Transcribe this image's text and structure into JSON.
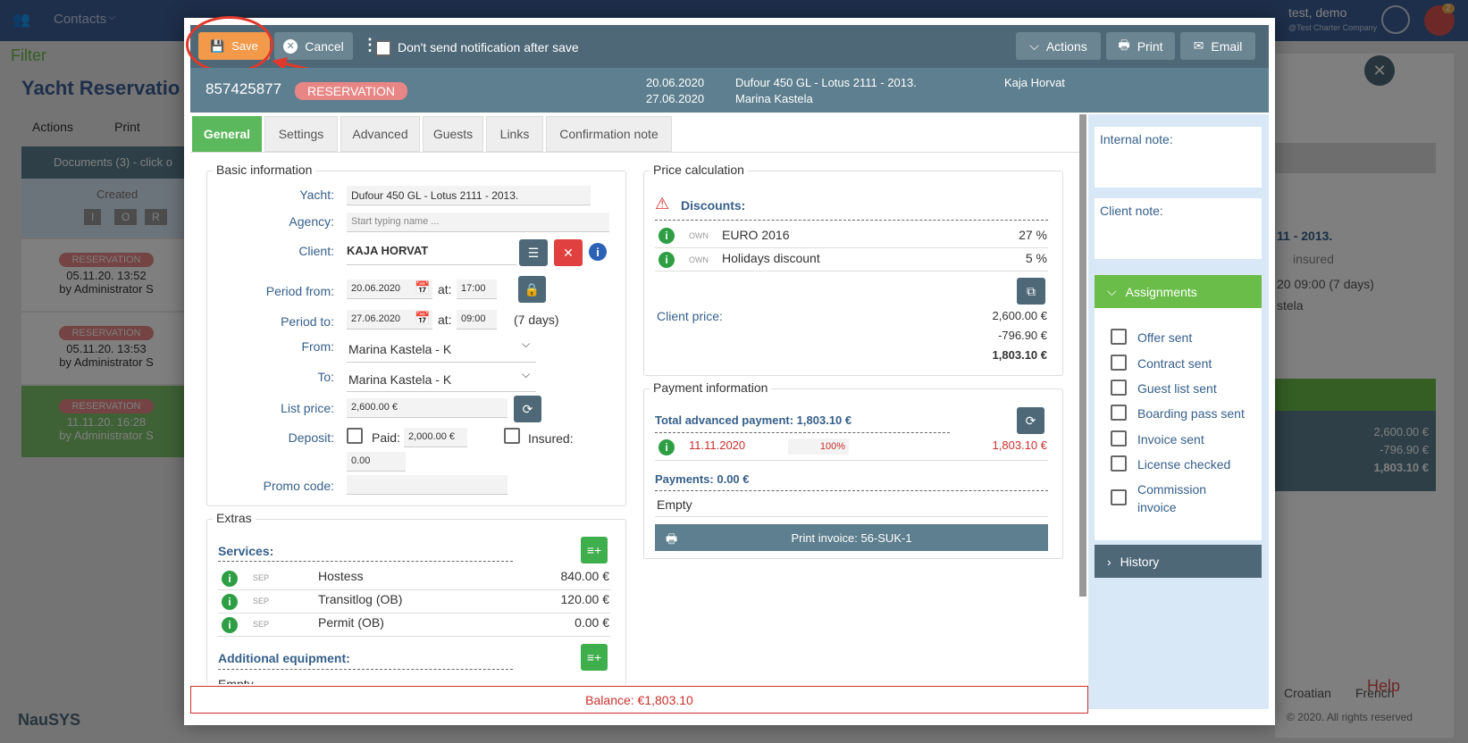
{
  "background": {
    "nav_contacts": "Contacts",
    "user_name": "test, demo",
    "company": "@Test Charter Company",
    "filter_label": "Filter",
    "page_title": "Yacht Reservatio",
    "actions": "Actions",
    "print": "Print",
    "documents": "Documents (3) - click o",
    "created": "Created",
    "col_i": "I",
    "col_o": "O",
    "col_r": "R",
    "rows": [
      {
        "badge": "RESERVATION",
        "date": "05.11.20. 13:52",
        "by": "by Administrator S"
      },
      {
        "badge": "RESERVATION",
        "date": "05.11.20. 13:53",
        "by": "by Administrator S"
      },
      {
        "badge": "RESERVATION",
        "date": "11.11.20. 16:28",
        "by": "by Administrator S"
      }
    ],
    "logo": "NauSYS",
    "right_yacht": "11 - 2013.",
    "right_insured": "insured",
    "right_period": "20 09:00 (7 days)",
    "right_marina": "stela",
    "right_price1": "2,600.00 €",
    "right_price2": "-796.90 €",
    "right_price3": "1,803.10 €",
    "lang_croatian": "Croatian",
    "lang_french": "French",
    "help": "Help",
    "copyright": "© 2020. All rights reserved",
    "notif_count": "2"
  },
  "toolbar": {
    "save": "Save",
    "cancel": "Cancel",
    "dont_send": "Don't send notification after save",
    "actions": "Actions",
    "print": "Print",
    "email": "Email"
  },
  "header": {
    "id": "857425877",
    "badge": "RESERVATION",
    "date_from": "20.06.2020",
    "date_to": "27.06.2020",
    "yacht": "Dufour 450 GL - Lotus 2111 - 2013.",
    "marina": "Marina Kastela",
    "client": "Kaja Horvat"
  },
  "tabs": [
    "General",
    "Settings",
    "Advanced",
    "Guests",
    "Links",
    "Confirmation note"
  ],
  "basic": {
    "legend": "Basic information",
    "yacht_label": "Yacht:",
    "yacht_value": "Dufour 450 GL - Lotus 2111 - 2013.",
    "agency_label": "Agency:",
    "agency_placeholder": "Start typing name ...",
    "client_label": "Client:",
    "client_value": "KAJA HORVAT",
    "period_from_label": "Period from:",
    "period_from": "20.06.2020",
    "at": "at:",
    "time_from": "17:00",
    "period_to_label": "Period to:",
    "period_to": "27.06.2020",
    "time_to": "09:00",
    "days": "(7 days)",
    "from_label": "From:",
    "from_value": "Marina Kastela - K",
    "to_label": "To:",
    "to_value": "Marina Kastela - K",
    "list_price_label": "List price:",
    "list_price": "2,600.00 €",
    "deposit_label": "Deposit:",
    "paid_label": "Paid:",
    "paid_value": "2,000.00 €",
    "insured_label": "Insured:",
    "deposit_value": "0.00",
    "promo_label": "Promo code:"
  },
  "extras": {
    "legend": "Extras",
    "services_label": "Services:",
    "services": [
      {
        "tag": "SEP",
        "name": "Hostess",
        "price": "840.00 €"
      },
      {
        "tag": "SEP",
        "name": "Transitlog (OB)",
        "price": "120.00 €"
      },
      {
        "tag": "SEP",
        "name": "Permit (OB)",
        "price": "0.00 €"
      }
    ],
    "equipment_label": "Additional equipment:",
    "equipment_empty": "Empty"
  },
  "price": {
    "legend": "Price calculation",
    "discounts_label": "Discounts:",
    "discounts": [
      {
        "tag": "OWN",
        "name": "EURO 2016",
        "value": "27 %"
      },
      {
        "tag": "OWN",
        "name": "Holidays discount",
        "value": "5 %"
      }
    ],
    "client_price_label": "Client price:",
    "amount": "2,600.00 €",
    "discount_amount": "-796.90 €",
    "total": "1,803.10 €"
  },
  "payment": {
    "legend": "Payment information",
    "total_advanced": "Total advanced payment: 1,803.10 €",
    "row_date": "11.11.2020",
    "row_percent": "100%",
    "row_amount": "1,803.10 €",
    "payments_label": "Payments: 0.00 €",
    "empty": "Empty",
    "print_invoice": "Print invoice: 56-SUK-1"
  },
  "side": {
    "internal_note": "Internal note:",
    "client_note": "Client note:",
    "assignments": "Assignments",
    "items": [
      "Offer sent",
      "Contract sent",
      "Guest list sent",
      "Boarding pass sent",
      "Invoice sent",
      "License checked",
      "Commission invoice"
    ],
    "history": "History"
  },
  "balance": "Balance: €1,803.10",
  "colors": {
    "save": "#f2994a",
    "annotation": "#e0392b",
    "active_tab": "#5cb85c"
  }
}
